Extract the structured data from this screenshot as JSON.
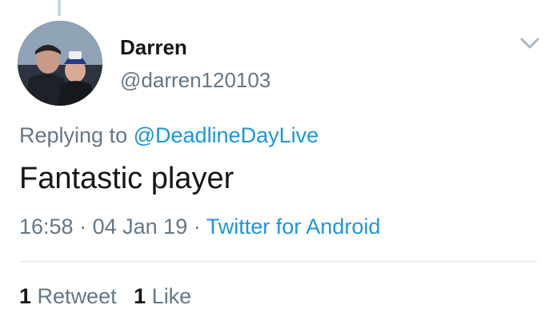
{
  "tweet": {
    "author": {
      "name": "Darren",
      "handle": "@darren120103"
    },
    "reply": {
      "prefix": "Replying to",
      "mention": "@DeadlineDayLive"
    },
    "text": "Fantastic player",
    "meta": {
      "time": "16:58",
      "separator": "·",
      "date": "04 Jan 19",
      "source": "Twitter for Android"
    },
    "stats": {
      "retweets_count": "1",
      "retweets_label": "Retweet",
      "likes_count": "1",
      "likes_label": "Like"
    },
    "icons": {
      "menu": "chevron-down-icon"
    },
    "colors": {
      "link": "#1b95e0",
      "secondary_text": "#657786",
      "primary_text": "#14171a",
      "divider": "#e1e8ed"
    }
  }
}
